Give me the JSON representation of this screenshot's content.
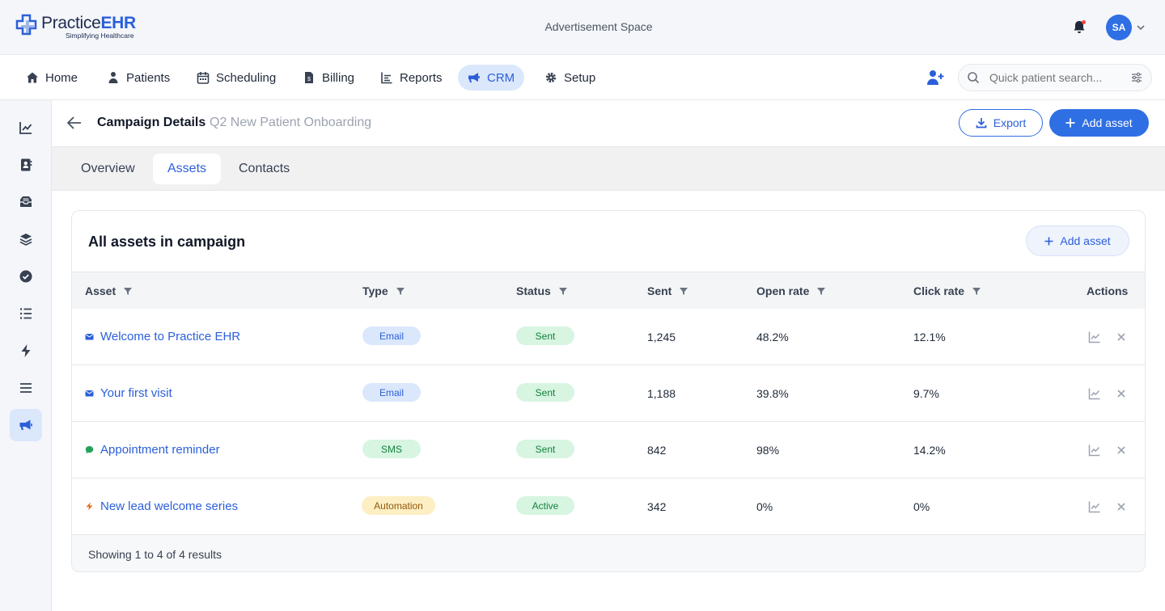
{
  "header": {
    "logo_main": "Practice",
    "logo_accent": "EHR",
    "logo_tagline": "Simplifying Healthcare",
    "ad_space": "Advertisement Space",
    "avatar_initials": "SA"
  },
  "nav": {
    "items": [
      {
        "label": "Home",
        "icon": "home-icon"
      },
      {
        "label": "Patients",
        "icon": "patients-icon"
      },
      {
        "label": "Scheduling",
        "icon": "calendar-icon"
      },
      {
        "label": "Billing",
        "icon": "billing-icon"
      },
      {
        "label": "Reports",
        "icon": "reports-icon"
      },
      {
        "label": "CRM",
        "icon": "megaphone-icon",
        "active": true
      },
      {
        "label": "Setup",
        "icon": "gear-icon"
      }
    ],
    "search_placeholder": "Quick patient search..."
  },
  "sidebar": {
    "items": [
      "chart-line-icon",
      "contact-book-icon",
      "inbox-icon",
      "layers-icon",
      "check-circle-icon",
      "list-icon",
      "bolt-icon",
      "menu-icon",
      "megaphone-icon"
    ],
    "active": "megaphone-icon"
  },
  "page": {
    "title": "Campaign Details",
    "subtitle": "Q2 New Patient Onboarding",
    "export_label": "Export",
    "add_asset_label": "Add asset"
  },
  "tabs": [
    {
      "label": "Overview"
    },
    {
      "label": "Assets",
      "active": true
    },
    {
      "label": "Contacts"
    }
  ],
  "card": {
    "title": "All assets in campaign",
    "add_asset_label": "Add asset",
    "columns": [
      "Asset",
      "Type",
      "Status",
      "Sent",
      "Open rate",
      "Click rate",
      "Actions"
    ],
    "rows": [
      {
        "asset": "Welcome to Practice EHR",
        "icon": "email-icon",
        "type": "Email",
        "status": "Sent",
        "sent": "1,245",
        "open_rate": "48.2%",
        "click_rate": "12.1%"
      },
      {
        "asset": "Your first visit",
        "icon": "email-icon",
        "type": "Email",
        "status": "Sent",
        "sent": "1,188",
        "open_rate": "39.8%",
        "click_rate": "9.7%"
      },
      {
        "asset": "Appointment reminder",
        "icon": "chat-icon",
        "type": "SMS",
        "status": "Sent",
        "sent": "842",
        "open_rate": "98%",
        "click_rate": "14.2%"
      },
      {
        "asset": "New lead welcome series",
        "icon": "bolt-icon",
        "type": "Automation",
        "status": "Active",
        "sent": "342",
        "open_rate": "0%",
        "click_rate": "0%"
      }
    ],
    "footer": "Showing 1 to 4 of 4 results"
  },
  "colors": {
    "accent": "#2f6fe4",
    "email_badge": "#dbe7fb",
    "success_badge": "#d7f5e1",
    "automation_badge": "#fdefc3"
  }
}
